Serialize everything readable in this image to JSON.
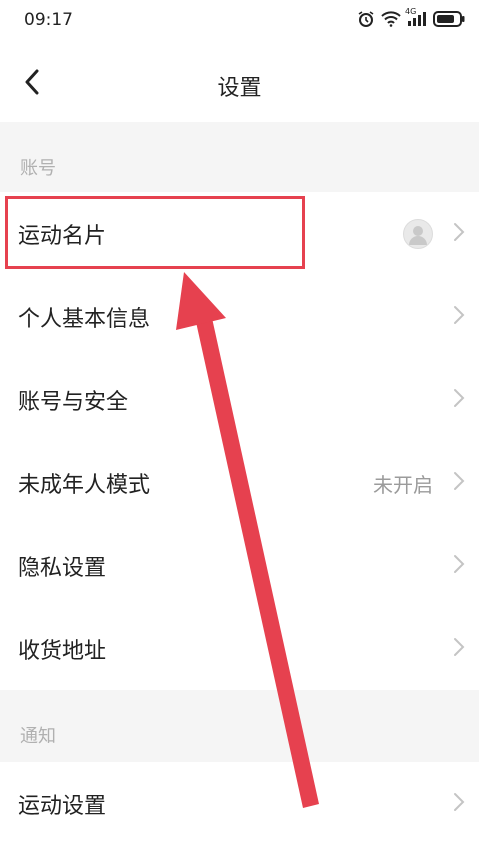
{
  "status_bar": {
    "time": "09:17",
    "network": "4G",
    "icons": [
      "alarm-icon",
      "wifi-icon",
      "signal-icon",
      "battery-icon"
    ]
  },
  "nav": {
    "back_icon": "chevron-left-icon",
    "title": "设置"
  },
  "sections": {
    "account": {
      "header": "账号",
      "items": [
        {
          "label": "运动名片",
          "value": "",
          "has_avatar": true
        },
        {
          "label": "个人基本信息",
          "value": ""
        },
        {
          "label": "账号与安全",
          "value": ""
        },
        {
          "label": "未成年人模式",
          "value": "未开启"
        },
        {
          "label": "隐私设置",
          "value": ""
        },
        {
          "label": "收货地址",
          "value": ""
        }
      ]
    },
    "notification": {
      "header": "通知",
      "items": [
        {
          "label": "运动设置",
          "value": ""
        }
      ]
    }
  },
  "colors": {
    "annotation_red": "#e6414f",
    "section_bg": "#f5f5f5",
    "secondary_text": "#9b9b9b"
  }
}
